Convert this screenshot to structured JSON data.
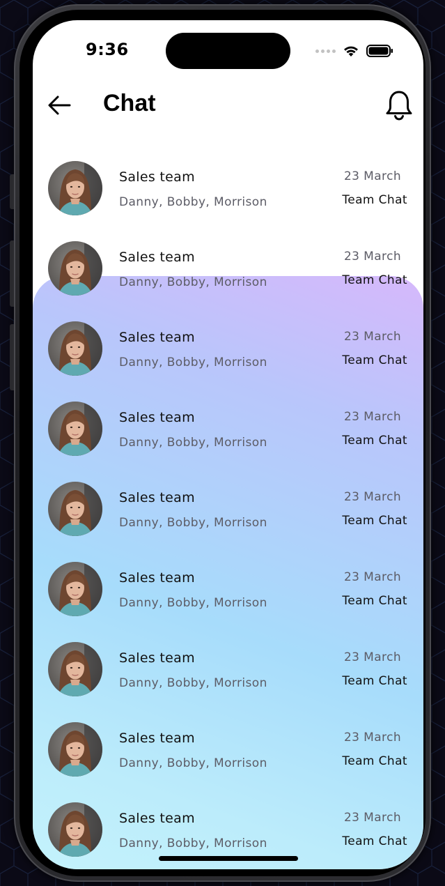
{
  "status_bar": {
    "time": "9:36",
    "wifi_icon": "wifi-icon",
    "battery_icon": "battery-icon"
  },
  "header": {
    "title": "Chat",
    "back_icon": "arrow-left-icon",
    "notifications_icon": "bell-icon"
  },
  "chats": [
    {
      "title": "Sales team",
      "members": "Danny, Bobby, Morrison",
      "date": "23 March",
      "type": "Team Chat"
    },
    {
      "title": "Sales team",
      "members": "Danny, Bobby, Morrison",
      "date": "23 March",
      "type": "Team Chat"
    },
    {
      "title": "Sales team",
      "members": "Danny, Bobby, Morrison",
      "date": "23 March",
      "type": "Team Chat"
    },
    {
      "title": "Sales team",
      "members": "Danny, Bobby, Morrison",
      "date": "23 March",
      "type": "Team Chat"
    },
    {
      "title": "Sales team",
      "members": "Danny, Bobby, Morrison",
      "date": "23 March",
      "type": "Team Chat"
    },
    {
      "title": "Sales team",
      "members": "Danny, Bobby, Morrison",
      "date": "23 March",
      "type": "Team Chat"
    },
    {
      "title": "Sales team",
      "members": "Danny, Bobby, Morrison",
      "date": "23 March",
      "type": "Team Chat"
    },
    {
      "title": "Sales team",
      "members": "Danny, Bobby, Morrison",
      "date": "23 March",
      "type": "Team Chat"
    },
    {
      "title": "Sales team",
      "members": "Danny, Bobby, Morrison",
      "date": "23 March",
      "type": "Team Chat"
    }
  ],
  "colors": {
    "gradient_top": "#d6b8fb",
    "gradient_mid": "#a7dcfb",
    "gradient_bottom": "#c6f4fc",
    "text_primary": "#111111",
    "text_secondary": "#5c5c66"
  }
}
